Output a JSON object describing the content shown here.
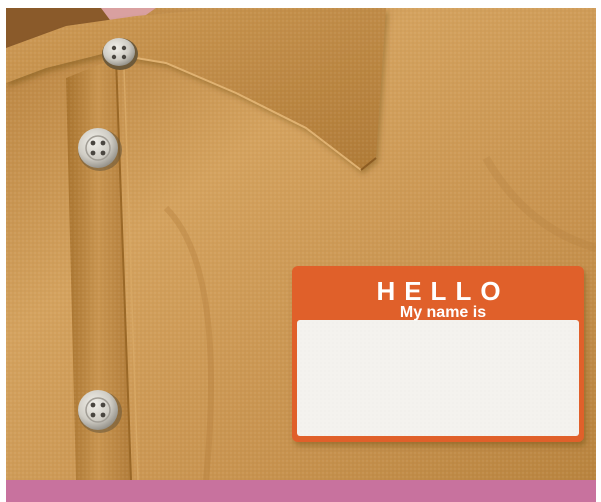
{
  "name_tag": {
    "header": "HELLO",
    "subheader": "My name is",
    "written_name": ""
  },
  "colors": {
    "shirt": "#c99550",
    "shirt_shadow": "#a87636",
    "tag_orange": "#e0602a",
    "tag_white": "#f4f2ee",
    "bottom_band": "#c8729e",
    "button": "#d9d6cf"
  },
  "scene": {
    "subject": "mustard-colored button-up shirt with blank name tag",
    "button_count": 3
  }
}
